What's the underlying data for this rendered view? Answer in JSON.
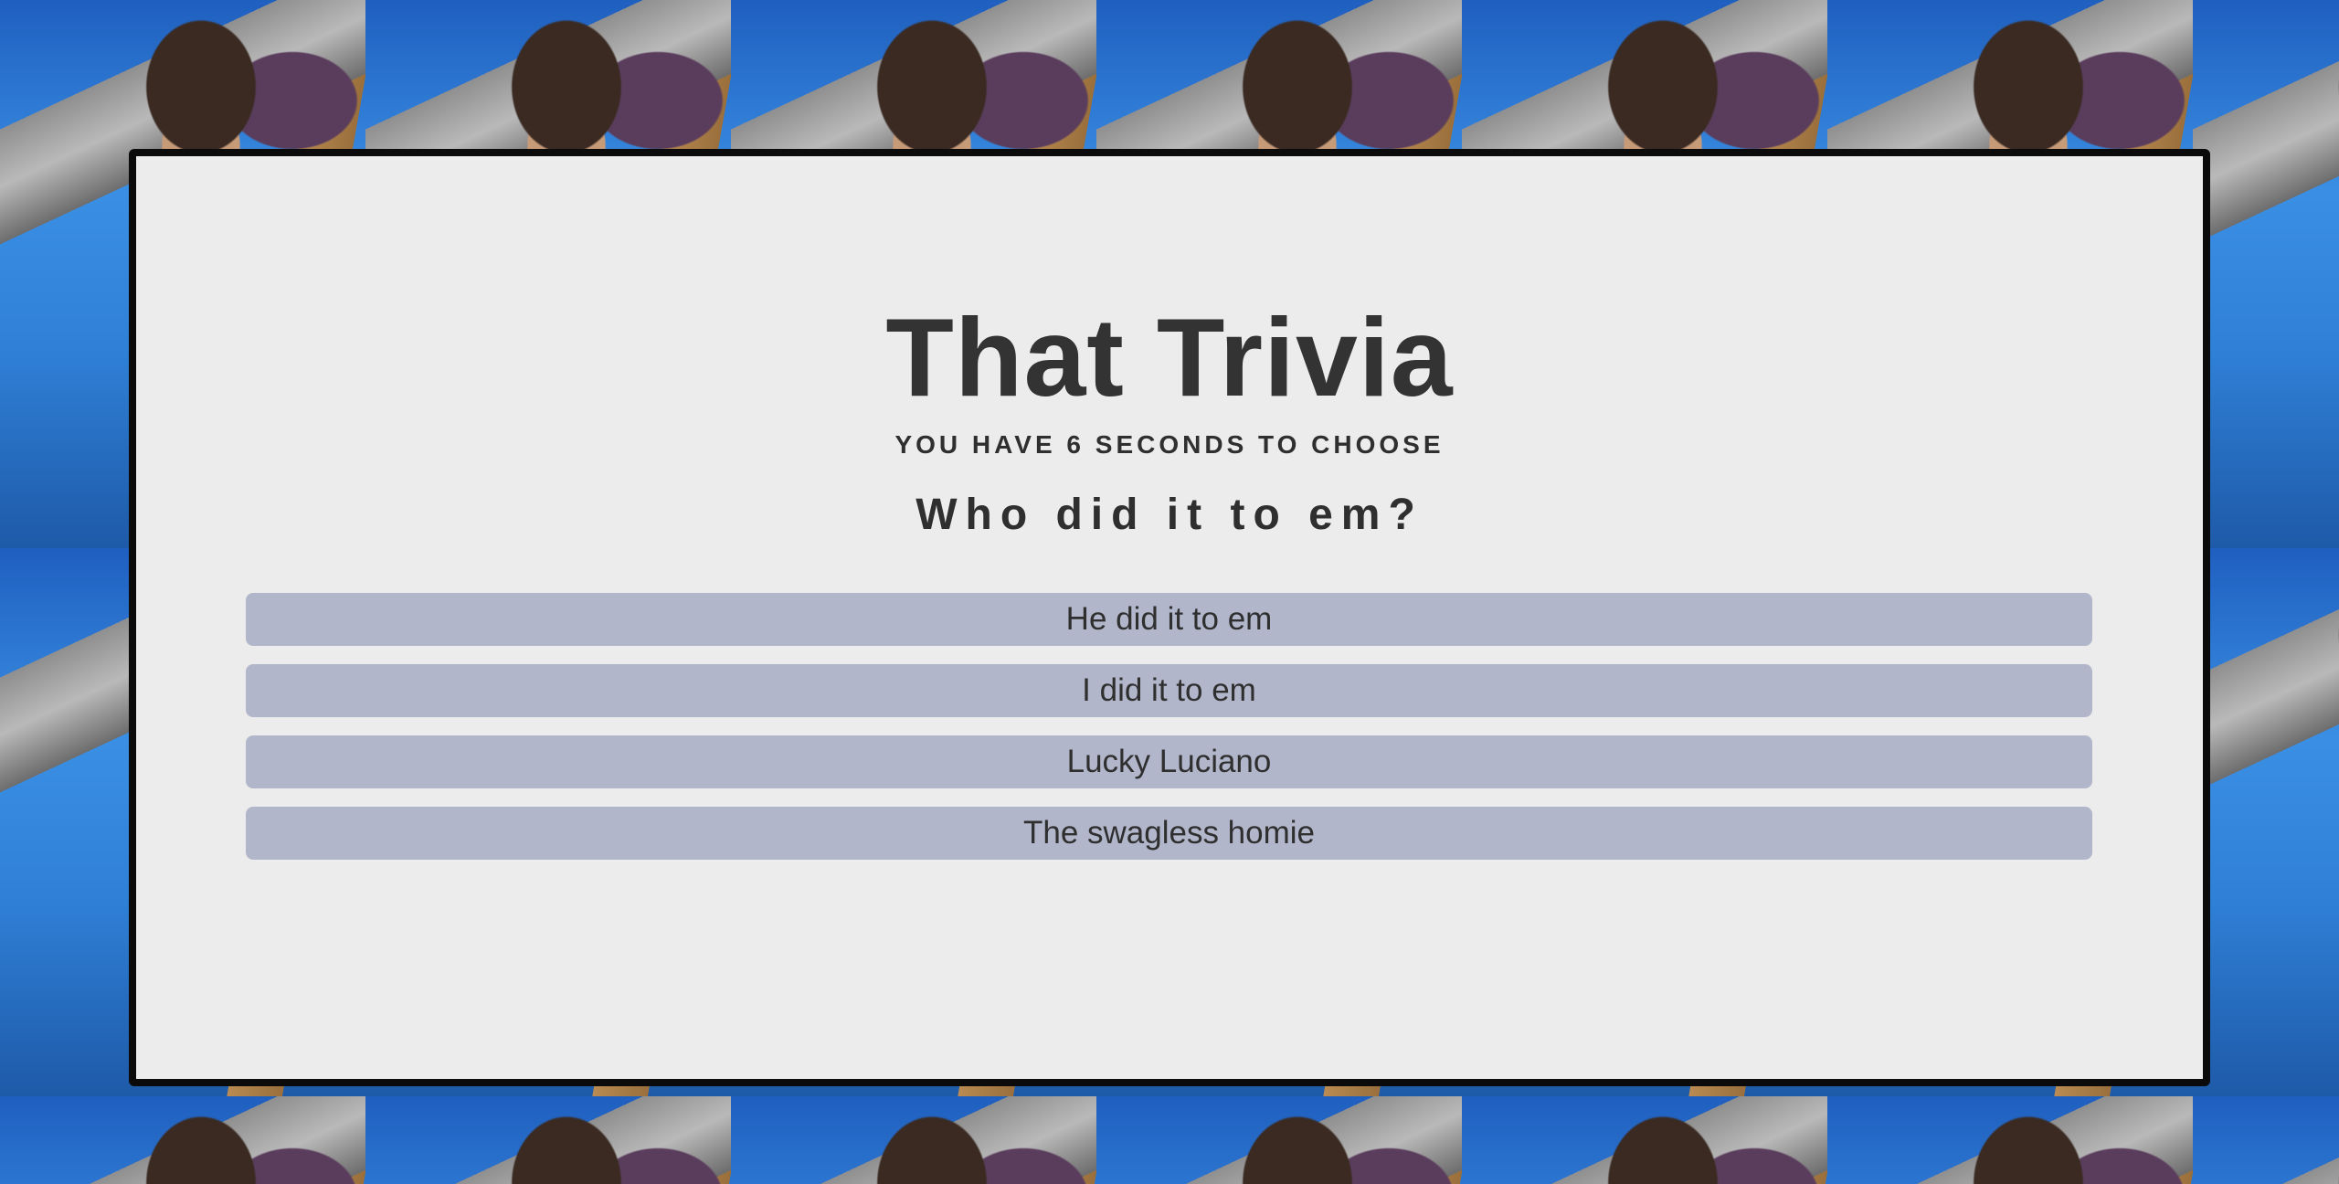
{
  "header": {
    "title": "That Trivia",
    "subtitle": "YOU HAVE 6 SECONDS TO CHOOSE"
  },
  "question": {
    "text": "Who did it to em?"
  },
  "options": [
    {
      "label": "He did it to em"
    },
    {
      "label": "I did it to em"
    },
    {
      "label": "Lucky Luciano"
    },
    {
      "label": "The swagless homie"
    }
  ],
  "colors": {
    "card_bg": "#ececec",
    "card_border": "#0b0b0b",
    "option_bg": "#b1b6ca",
    "text": "#333333"
  }
}
